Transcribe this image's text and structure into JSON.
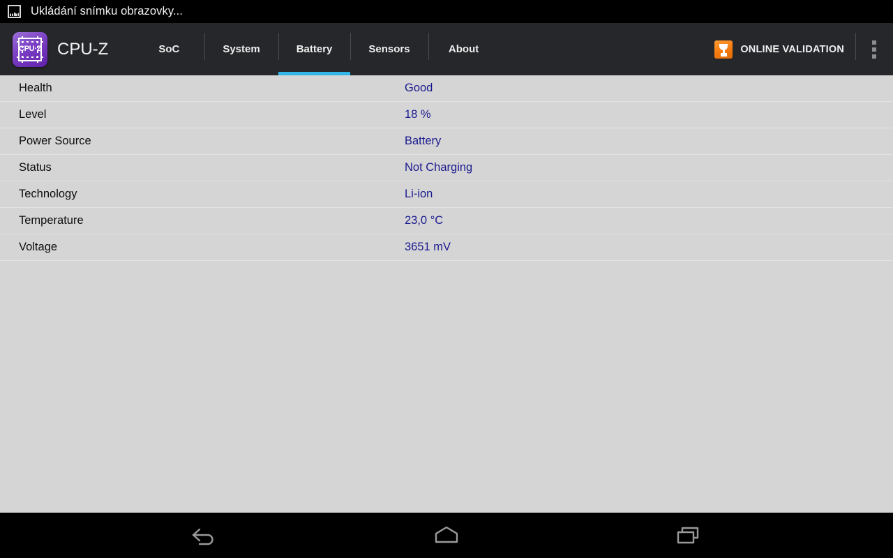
{
  "status_bar": {
    "notification_icon": "screenshot-image-icon",
    "text": "Ukládání snímku obrazovky..."
  },
  "action_bar": {
    "logo_icon": "cpuz-chip-logo",
    "logo_text": "CPU·Z",
    "app_title": "CPU-Z",
    "tabs": [
      {
        "label": "SoC",
        "active": false
      },
      {
        "label": "System",
        "active": false
      },
      {
        "label": "Battery",
        "active": true
      },
      {
        "label": "Sensors",
        "active": false
      },
      {
        "label": "About",
        "active": false
      }
    ],
    "validation": {
      "icon": "trophy-icon",
      "label": "ONLINE VALIDATION"
    },
    "overflow_icon": "overflow-menu-icon",
    "accent_color": "#33b5e5",
    "background_color": "#26272b"
  },
  "battery": {
    "rows": [
      {
        "label": "Health",
        "value": "Good"
      },
      {
        "label": "Level",
        "value": "18 %"
      },
      {
        "label": "Power Source",
        "value": "Battery"
      },
      {
        "label": "Status",
        "value": "Not Charging"
      },
      {
        "label": "Technology",
        "value": "Li-ion"
      },
      {
        "label": "Temperature",
        "value": "23,0 °C"
      },
      {
        "label": "Voltage",
        "value": "3651 mV"
      }
    ],
    "value_color": "#1a1a8f",
    "background_color": "#d5d5d5"
  },
  "nav_bar": {
    "buttons": [
      {
        "name": "back-button",
        "icon": "back-arrow-icon"
      },
      {
        "name": "home-button",
        "icon": "home-icon"
      },
      {
        "name": "recents-button",
        "icon": "recents-icon"
      }
    ]
  }
}
